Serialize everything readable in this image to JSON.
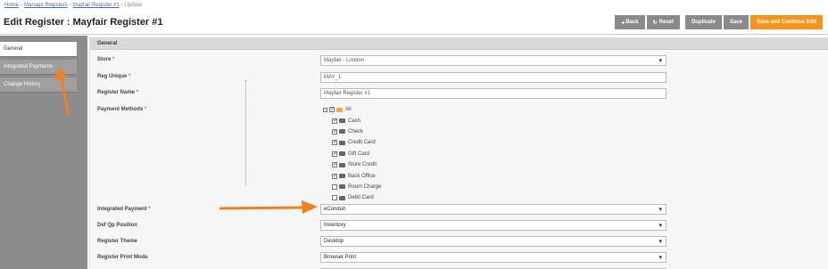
{
  "breadcrumb": {
    "home": "Home",
    "manage_registers": "Manage Registers",
    "register": "Mayfair Register #1",
    "current": "Update"
  },
  "page_title": "Edit Register : Mayfair Register #1",
  "toolbar": {
    "back": "Back",
    "reset": "Reset",
    "duplicate": "Duplicate",
    "save": "Save",
    "save_continue": "Save and Continue Edit"
  },
  "sidebar": {
    "items": [
      {
        "label": "General"
      },
      {
        "label": "Integrated Payments"
      },
      {
        "label": "Change History"
      }
    ]
  },
  "panel": {
    "header": "General"
  },
  "form": {
    "store": {
      "label": "Store",
      "value": "Mayfair - London"
    },
    "reg_unique": {
      "label": "Reg Unique",
      "value": "MAY_1"
    },
    "register_name": {
      "label": "Register Name",
      "value": "Mayfair Register #1"
    },
    "payment_methods": {
      "label": "Payment Methods"
    },
    "integrated_payment": {
      "label": "Integrated Payment",
      "value": "eConduit"
    },
    "def_qp_position": {
      "label": "Def Qp Position",
      "value": "Inventory"
    },
    "register_theme": {
      "label": "Register Theme",
      "value": "Desktop"
    },
    "register_print_mode": {
      "label": "Register Print Mode",
      "value": "Browser Print"
    }
  },
  "payment_tree": {
    "root": "All",
    "items": [
      {
        "label": "Cash",
        "checked": true
      },
      {
        "label": "Check",
        "checked": true
      },
      {
        "label": "Credit Card",
        "checked": true
      },
      {
        "label": "Gift Card",
        "checked": true
      },
      {
        "label": "Store Credit",
        "checked": true
      },
      {
        "label": "Back Office",
        "checked": true
      },
      {
        "label": "Room Charge",
        "checked": false
      },
      {
        "label": "Debit Card",
        "checked": false
      }
    ]
  },
  "colors": {
    "accent": "#f7941d",
    "button_gray": "#8a8a8a",
    "sidebar": "#8c8c8c"
  }
}
